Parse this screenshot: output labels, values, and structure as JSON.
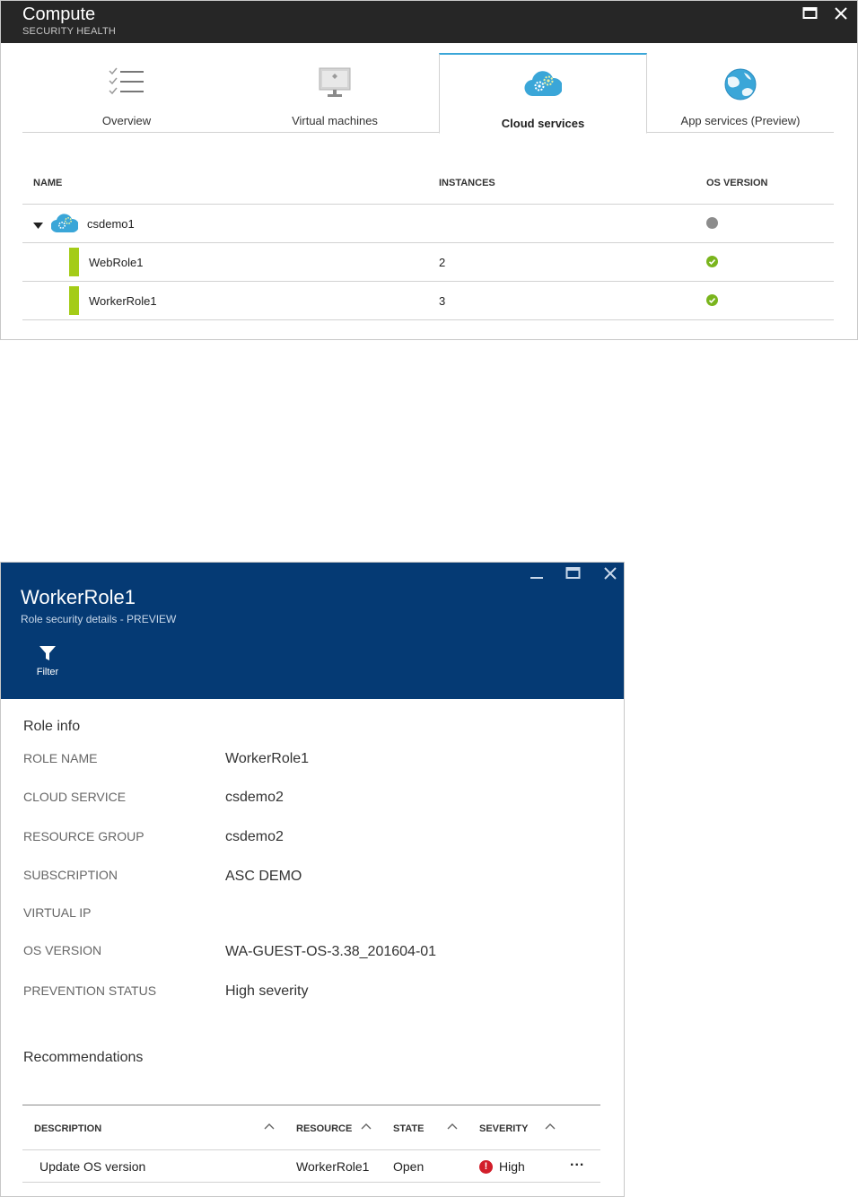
{
  "compute": {
    "title": "Compute",
    "subtitle": "SECURITY HEALTH",
    "tabs": [
      {
        "label": "Overview",
        "icon": "checklist-icon"
      },
      {
        "label": "Virtual machines",
        "icon": "virtual-machine-icon"
      },
      {
        "label": "Cloud services",
        "icon": "cloud-gears-icon",
        "active": true
      },
      {
        "label": "App services (Preview)",
        "icon": "app-services-globe-icon"
      }
    ],
    "columns": {
      "name": "NAME",
      "instances": "INSTANCES",
      "os_version": "OS VERSION"
    },
    "service": {
      "name": "csdemo1",
      "os_status": "unknown"
    },
    "roles": [
      {
        "name": "WebRole1",
        "instances": "2",
        "os_status": "healthy"
      },
      {
        "name": "WorkerRole1",
        "instances": "3",
        "os_status": "healthy"
      }
    ]
  },
  "role_blade": {
    "title": "WorkerRole1",
    "subtitle": "Role security details - PREVIEW",
    "filter_label": "Filter",
    "role_info_title": "Role info",
    "info": [
      {
        "label": "ROLE NAME",
        "value": "WorkerRole1"
      },
      {
        "label": "CLOUD SERVICE",
        "value": "csdemo2"
      },
      {
        "label": "RESOURCE GROUP",
        "value": "csdemo2"
      },
      {
        "label": "SUBSCRIPTION",
        "value": "ASC DEMO"
      },
      {
        "label": "VIRTUAL IP",
        "value": ""
      },
      {
        "label": "OS VERSION",
        "value": "WA-GUEST-OS-3.38_201604-01"
      },
      {
        "label": "PREVENTION STATUS",
        "value": "High severity"
      }
    ],
    "recommendations_title": "Recommendations",
    "rec_columns": {
      "description": "DESCRIPTION",
      "resource": "RESOURCE",
      "state": "STATE",
      "severity": "SEVERITY"
    },
    "recommendations": [
      {
        "description": "Update OS version",
        "resource": "WorkerRole1",
        "state": "Open",
        "severity": "High",
        "more": "..."
      }
    ]
  },
  "colors": {
    "header_dark": "#262626",
    "blade_header": "#053a74",
    "active_tab_accent": "#3aa6d8",
    "role_bar": "#a4cc18",
    "healthy": "#7ab51d",
    "unknown": "#8c8c8c",
    "high_severity": "#d21e2a"
  }
}
